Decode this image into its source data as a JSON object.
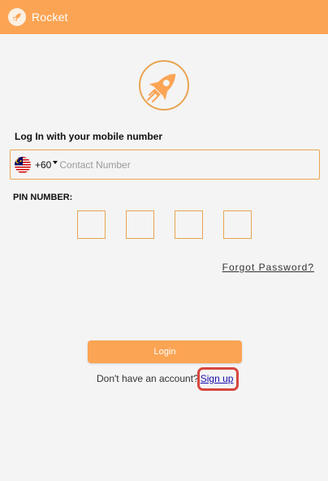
{
  "header": {
    "title": "Rocket",
    "logo_icon": "rocket-icon",
    "background_color": "#fba454"
  },
  "login": {
    "heading": "Log In with your mobile number",
    "country_code": "+60",
    "flag_icon": "malaysia-flag-icon",
    "phone_placeholder": "Contact Number",
    "pin_label": "PIN NUMBER:",
    "pin_values": [
      "",
      "",
      "",
      ""
    ],
    "forgot_label": "Forgot Password?",
    "login_label": "Login",
    "no_account_text": "Don't have an account?",
    "signup_label": "Sign up"
  },
  "colors": {
    "accent": "#fba454",
    "border": "#e8a452",
    "link": "#1a0dab",
    "highlight": "#d7463d"
  }
}
